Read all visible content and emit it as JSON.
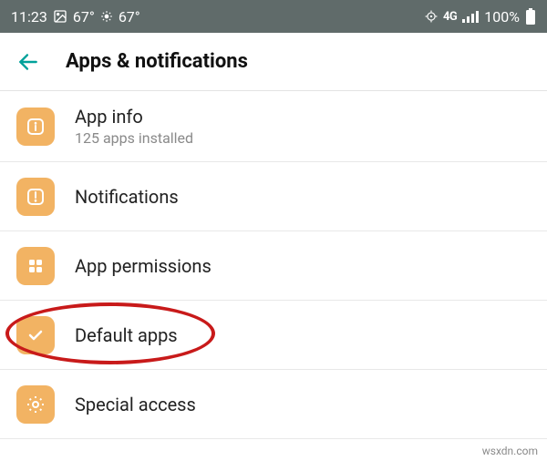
{
  "statusBar": {
    "time": "11:23",
    "temp1": "67°",
    "temp2": "67°",
    "network": "4G",
    "battery": "100%"
  },
  "header": {
    "title": "Apps & notifications"
  },
  "items": [
    {
      "title": "App info",
      "subtitle": "125 apps installed",
      "icon": "info"
    },
    {
      "title": "Notifications",
      "subtitle": null,
      "icon": "notifications"
    },
    {
      "title": "App permissions",
      "subtitle": null,
      "icon": "permissions"
    },
    {
      "title": "Default apps",
      "subtitle": null,
      "icon": "default",
      "highlighted": true
    },
    {
      "title": "Special access",
      "subtitle": null,
      "icon": "special"
    }
  ],
  "attribution": "wsxdn.com"
}
